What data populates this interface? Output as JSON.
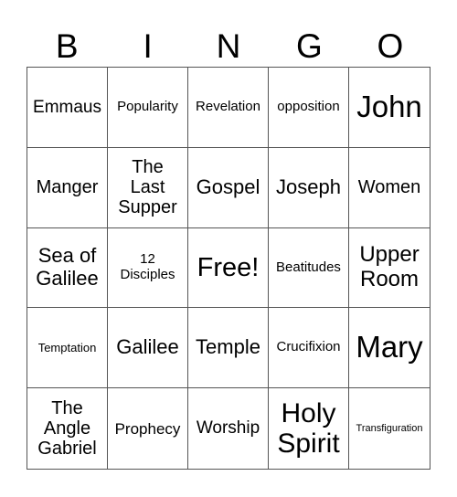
{
  "header": [
    "B",
    "I",
    "N",
    "G",
    "O"
  ],
  "cells": [
    [
      "Emmaus",
      "Popularity",
      "Revelation",
      "opposition",
      "John"
    ],
    [
      "Manger",
      "The Last Supper",
      "Gospel",
      "Joseph",
      "Women"
    ],
    [
      "Sea of Galilee",
      "12 Disciples",
      "Free!",
      "Beatitudes",
      "Upper Room"
    ],
    [
      "Temptation",
      "Galilee",
      "Temple",
      "Crucifixion",
      "Mary"
    ],
    [
      "The Angle Gabriel",
      "Prophecy",
      "Worship",
      "Holy Spirit",
      "Transfiguration"
    ]
  ]
}
